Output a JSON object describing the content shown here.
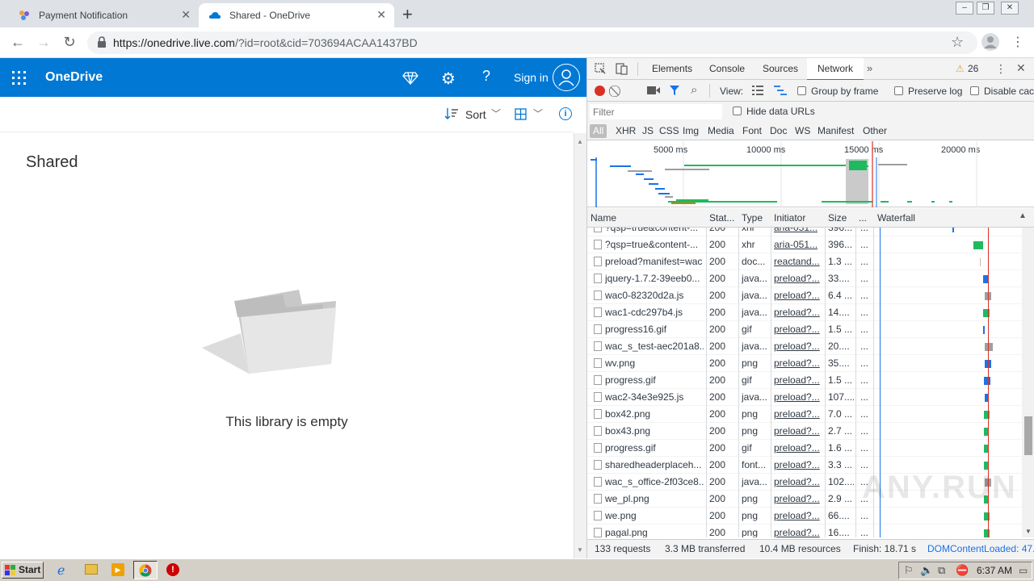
{
  "browser": {
    "tabs": [
      {
        "title": "Payment Notification"
      },
      {
        "title": "Shared - OneDrive"
      }
    ],
    "url_host": "https://onedrive.live.com",
    "url_path": "/?id=root&cid=703694ACAA1437BD"
  },
  "onedrive": {
    "app_name": "OneDrive",
    "sign_in": "Sign in",
    "sort_label": "Sort",
    "page_title": "Shared",
    "empty_message": "This library is empty"
  },
  "devtools": {
    "tabs": [
      "Elements",
      "Console",
      "Sources",
      "Network"
    ],
    "warning_count": "26",
    "toolbar": {
      "view_label": "View:",
      "group_by_frame": "Group by frame",
      "preserve_log": "Preserve log",
      "disable_cache": "Disable cac"
    },
    "filter_placeholder": "Filter",
    "hide_data_urls": "Hide data URLs",
    "type_filters": [
      "All",
      "XHR",
      "JS",
      "CSS",
      "Img",
      "Media",
      "Font",
      "Doc",
      "WS",
      "Manifest",
      "Other"
    ],
    "timeline_ticks": [
      "5000 ms",
      "10000 ms",
      "15000 ms",
      "20000 ms"
    ],
    "columns": [
      "Name",
      "Stat...",
      "Type",
      "Initiator",
      "Size",
      "...",
      "Waterfall"
    ],
    "rows": [
      {
        "name": "?qsp=true&content-...",
        "status": "200",
        "type": "xhr",
        "initiator": "aria-051...",
        "size": "396..."
      },
      {
        "name": "?qsp=true&content-...",
        "status": "200",
        "type": "xhr",
        "initiator": "aria-051...",
        "size": "396..."
      },
      {
        "name": "preload?manifest=wac",
        "status": "200",
        "type": "doc...",
        "initiator": "reactand...",
        "size": "1.3 ..."
      },
      {
        "name": "jquery-1.7.2-39eeb0...",
        "status": "200",
        "type": "java...",
        "initiator": "preload?...",
        "size": "33...."
      },
      {
        "name": "wac0-82320d2a.js",
        "status": "200",
        "type": "java...",
        "initiator": "preload?...",
        "size": "6.4 ..."
      },
      {
        "name": "wac1-cdc297b4.js",
        "status": "200",
        "type": "java...",
        "initiator": "preload?...",
        "size": "14...."
      },
      {
        "name": "progress16.gif",
        "status": "200",
        "type": "gif",
        "initiator": "preload?...",
        "size": "1.5 ..."
      },
      {
        "name": "wac_s_test-aec201a8...",
        "status": "200",
        "type": "java...",
        "initiator": "preload?...",
        "size": "20...."
      },
      {
        "name": "wv.png",
        "status": "200",
        "type": "png",
        "initiator": "preload?...",
        "size": "35...."
      },
      {
        "name": "progress.gif",
        "status": "200",
        "type": "gif",
        "initiator": "preload?...",
        "size": "1.5 ..."
      },
      {
        "name": "wac2-34e3e925.js",
        "status": "200",
        "type": "java...",
        "initiator": "preload?...",
        "size": "107...."
      },
      {
        "name": "box42.png",
        "status": "200",
        "type": "png",
        "initiator": "preload?...",
        "size": "7.0 ..."
      },
      {
        "name": "box43.png",
        "status": "200",
        "type": "png",
        "initiator": "preload?...",
        "size": "2.7 ..."
      },
      {
        "name": "progress.gif",
        "status": "200",
        "type": "gif",
        "initiator": "preload?...",
        "size": "1.6 ..."
      },
      {
        "name": "sharedheaderplaceh...",
        "status": "200",
        "type": "font...",
        "initiator": "preload?...",
        "size": "3.3 ..."
      },
      {
        "name": "wac_s_office-2f03ce8...",
        "status": "200",
        "type": "java...",
        "initiator": "preload?...",
        "size": "102...."
      },
      {
        "name": "we_pl.png",
        "status": "200",
        "type": "png",
        "initiator": "preload?...",
        "size": "2.9 ..."
      },
      {
        "name": "we.png",
        "status": "200",
        "type": "png",
        "initiator": "preload?...",
        "size": "66...."
      },
      {
        "name": "pagal.png",
        "status": "200",
        "type": "png",
        "initiator": "preload?...",
        "size": "16...."
      }
    ],
    "status_bar": {
      "requests": "133 requests",
      "transferred": "3.3 MB transferred",
      "resources": "10.4 MB resources",
      "finish": "Finish: 18.71 s",
      "dcl": "DOMContentLoaded: 47..."
    }
  },
  "taskbar": {
    "start_label": "Start",
    "clock": "6:37 AM"
  },
  "watermark": "ANY.RUN"
}
